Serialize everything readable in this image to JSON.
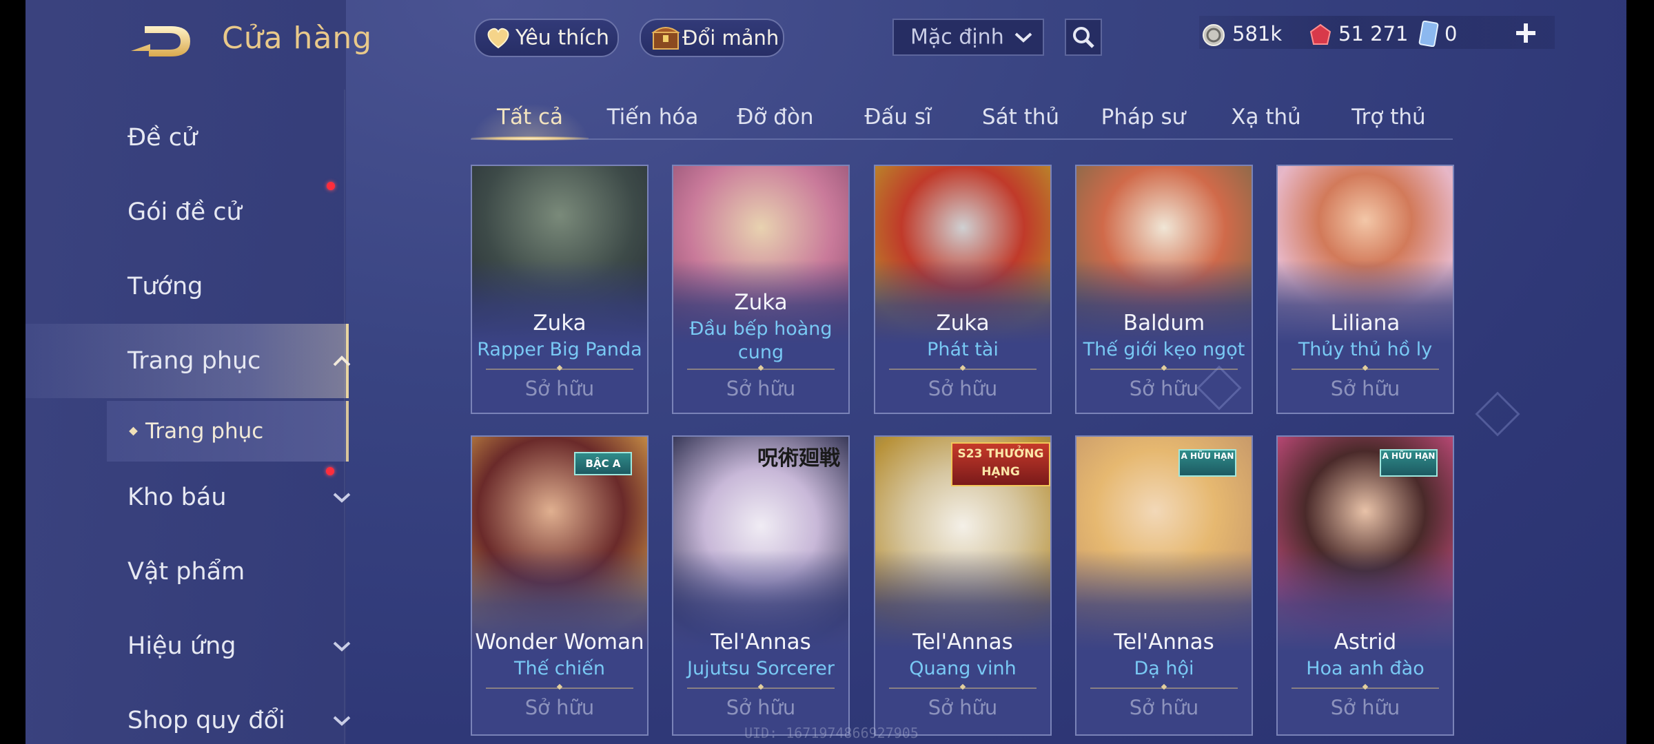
{
  "header": {
    "title": "Cửa hàng",
    "favorite_label": "Yêu thích",
    "exchange_label": "Đổi mảnh",
    "sort_value": "Mặc định",
    "currencies": [
      {
        "name": "gold",
        "value": "581k"
      },
      {
        "name": "vouchers",
        "value": "51 271"
      },
      {
        "name": "skin-cards",
        "value": "0"
      }
    ]
  },
  "sidebar": {
    "items": [
      {
        "label": "Đề cử"
      },
      {
        "label": "Gói đề cử"
      },
      {
        "label": "Tướng"
      },
      {
        "label": "Trang phục"
      },
      {
        "label": "Kho báu"
      },
      {
        "label": "Vật phẩm"
      },
      {
        "label": "Hiệu ứng"
      },
      {
        "label": "Shop quy đổi"
      }
    ],
    "sub_item": "Trang phục"
  },
  "tabs": [
    "Tất cả",
    "Tiến hóa",
    "Đỡ đòn",
    "Đấu sĩ",
    "Sát thủ",
    "Pháp sư",
    "Xạ thủ",
    "Trợ thủ"
  ],
  "active_tab": "Tất cả",
  "cards": [
    {
      "hero": "Zuka",
      "skin": "Rapper Big Panda",
      "status": "Sở hữu"
    },
    {
      "hero": "Zuka",
      "skin": "Đầu bếp hoàng cung",
      "status": "Sở hữu"
    },
    {
      "hero": "Zuka",
      "skin": "Phát tài",
      "status": "Sở hữu"
    },
    {
      "hero": "Baldum",
      "skin": "Thế giới kẹo ngọt",
      "status": "Sở hữu"
    },
    {
      "hero": "Liliana",
      "skin": "Thủy thủ hồ ly",
      "status": "Sở hữu"
    },
    {
      "hero": "Wonder Woman",
      "skin": "Thế chiến",
      "status": "Sở hữu",
      "badge": "BẬC A"
    },
    {
      "hero": "Tel'Annas",
      "skin": "Jujutsu Sorcerer",
      "status": "Sở hữu",
      "badge": "呪術廻戦"
    },
    {
      "hero": "Tel'Annas",
      "skin": "Quang vinh",
      "status": "Sở hữu",
      "badge": "S23 THƯỞNG HẠNG"
    },
    {
      "hero": "Tel'Annas",
      "skin": "Dạ hội",
      "status": "Sở hữu",
      "badge": "A HỮU HẠN"
    },
    {
      "hero": "Astrid",
      "skin": "Hoa anh đào",
      "status": "Sở hữu",
      "badge": "A HỮU HẠN"
    }
  ],
  "uid": "UID: 1671974866927905"
}
